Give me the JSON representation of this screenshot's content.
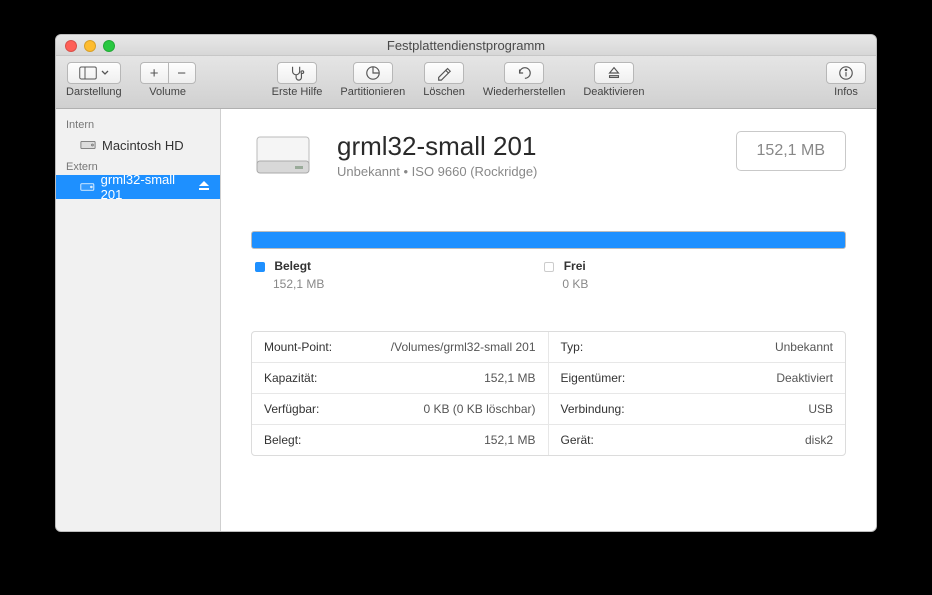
{
  "window": {
    "title": "Festplattendienstprogramm"
  },
  "toolbar": {
    "view": "Darstellung",
    "volume": "Volume",
    "firstaid": "Erste Hilfe",
    "partition": "Partitionieren",
    "erase": "Löschen",
    "restore": "Wiederherstellen",
    "deactivate": "Deaktivieren",
    "info": "Infos"
  },
  "sidebar": {
    "intern": "Intern",
    "mac": "Macintosh HD",
    "extern": "Extern",
    "ext1": "grml32-small 201"
  },
  "volume": {
    "name": "grml32-small 201",
    "subtitle": "Unbekannt • ISO 9660 (Rockridge)",
    "size": "152,1 MB"
  },
  "legend": {
    "used_label": "Belegt",
    "used_value": "152,1 MB",
    "free_label": "Frei",
    "free_value": "0 KB"
  },
  "details": {
    "mountpoint_k": "Mount-Point:",
    "mountpoint_v": "/Volumes/grml32-small 201",
    "type_k": "Typ:",
    "type_v": "Unbekannt",
    "capacity_k": "Kapazität:",
    "capacity_v": "152,1 MB",
    "owner_k": "Eigentümer:",
    "owner_v": "Deaktiviert",
    "avail_k": "Verfügbar:",
    "avail_v": "0 KB (0 KB löschbar)",
    "conn_k": "Verbindung:",
    "conn_v": "USB",
    "used_k": "Belegt:",
    "used_v": "152,1 MB",
    "device_k": "Gerät:",
    "device_v": "disk2"
  }
}
